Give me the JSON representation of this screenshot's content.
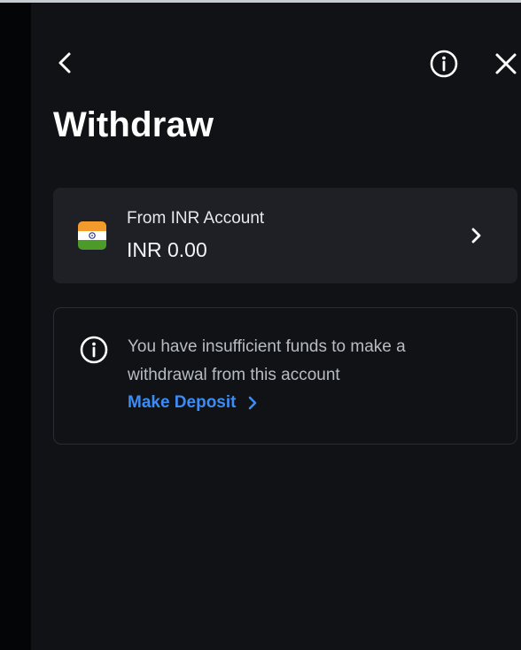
{
  "header": {
    "back_icon": "chevron-left-icon",
    "info_icon": "info-circle-icon",
    "close_icon": "close-icon"
  },
  "page": {
    "title": "Withdraw"
  },
  "account": {
    "label": "From INR Account",
    "balance": "INR 0.00",
    "flag_icon": "india-flag-icon",
    "chevron_icon": "chevron-right-icon"
  },
  "notice": {
    "icon": "info-circle-icon",
    "message": "You have insufficient funds to make a withdrawal from this account",
    "action_label": "Make Deposit",
    "action_icon": "chevron-right-icon"
  },
  "colors": {
    "background": "#101216",
    "card": "#1e2026",
    "text_primary": "#ffffff",
    "text_secondary": "#b7bcc3",
    "accent": "#3b8cf5"
  }
}
